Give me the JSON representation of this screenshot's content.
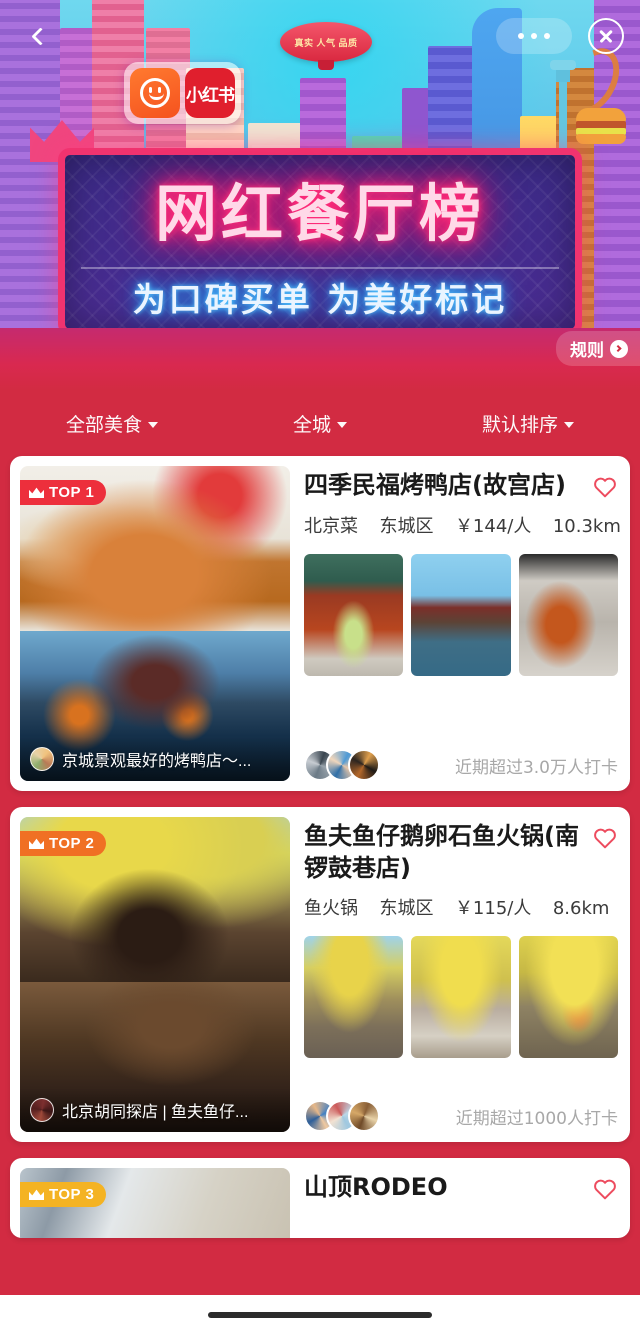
{
  "header": {
    "back_icon": "chevron-left-icon",
    "more_icon": "more-dots-icon",
    "close_icon": "close-circle-icon",
    "rules_label": "规则",
    "rules_arrow_icon": "chevron-right-circle-icon"
  },
  "banner": {
    "brand_name": "小红书",
    "brand_icon": "xiaohongshu-smiley-icon",
    "blimp_text": "真实 人气 品质",
    "title": "网红餐厅榜",
    "subtitle": "为口碑买单 为美好标记",
    "colors": {
      "neon_pink": "#ff2d7a",
      "neon_blue": "#56c8ff",
      "page_red": "#D22B42"
    }
  },
  "filters": [
    {
      "label": "全部美食",
      "caret_icon": "caret-down-icon"
    },
    {
      "label": "全城",
      "caret_icon": "caret-down-icon"
    },
    {
      "label": "默认排序",
      "caret_icon": "caret-down-icon"
    }
  ],
  "cards": [
    {
      "rank_badge": "TOP 1",
      "rank_badge_color": "#ED2F3C",
      "crown_icon": "crown-icon",
      "photo_caption": "京城景观最好的烤鸭店～...",
      "shop_name": "四季民福烤鸭店(故宫店)",
      "cuisine": "北京菜",
      "district": "东城区",
      "price": "￥144/人",
      "distance": "10.3km",
      "favorite_icon": "heart-outline-icon",
      "footer_note": "近期超过3.0万人打卡"
    },
    {
      "rank_badge": "TOP 2",
      "rank_badge_color": "#F07024",
      "crown_icon": "crown-icon",
      "photo_caption": "北京胡同探店 | 鱼夫鱼仔...",
      "shop_name": "鱼夫鱼仔鹅卵石鱼火锅(南锣鼓巷店)",
      "cuisine": "鱼火锅",
      "district": "东城区",
      "price": "￥115/人",
      "distance": "8.6km",
      "favorite_icon": "heart-outline-icon",
      "footer_note": "近期超过1000人打卡"
    },
    {
      "rank_badge": "TOP 3",
      "rank_badge_color": "#F4B323",
      "crown_icon": "crown-icon",
      "shop_name": "山顶RODEO",
      "favorite_icon": "heart-outline-icon"
    }
  ],
  "system": {
    "home_indicator": "home-indicator-bar"
  }
}
